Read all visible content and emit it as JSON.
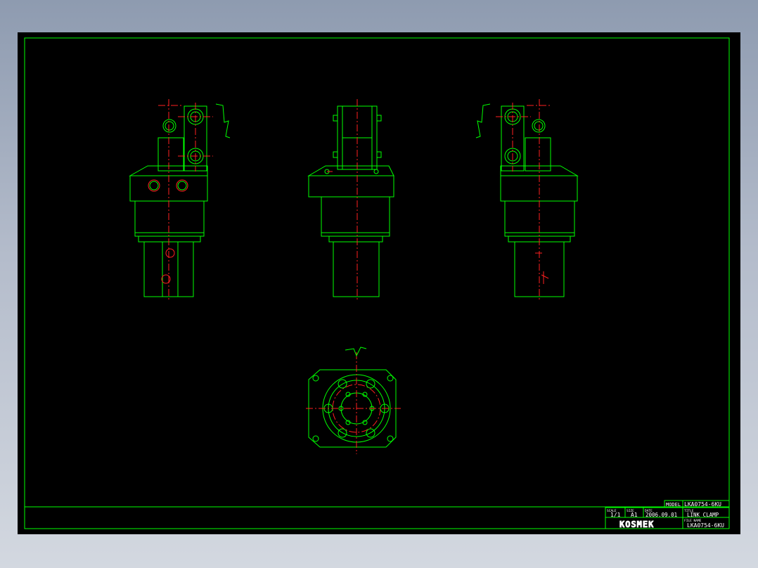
{
  "colors": {
    "background": "#000000",
    "outline": "#00ff00",
    "centerline": "#ff0000",
    "text": "#ffffff"
  },
  "title_block": {
    "model_label": "MODEL",
    "model_value": "LKA0754-6KU",
    "scale_label": "SCALE",
    "scale_value": "1/1",
    "size_label": "SIZE",
    "size_value": "A1",
    "date_label": "DATE",
    "date_value": "2006.09.01",
    "title_label": "TITLE",
    "title_value": "LINK CLAMP",
    "filename_label": "FILE NAME",
    "filename_value": "LKA0754-6KU",
    "company_logo": "KOSMEK"
  },
  "views": [
    "left-side-view",
    "front-view",
    "right-side-view",
    "bottom-view"
  ]
}
